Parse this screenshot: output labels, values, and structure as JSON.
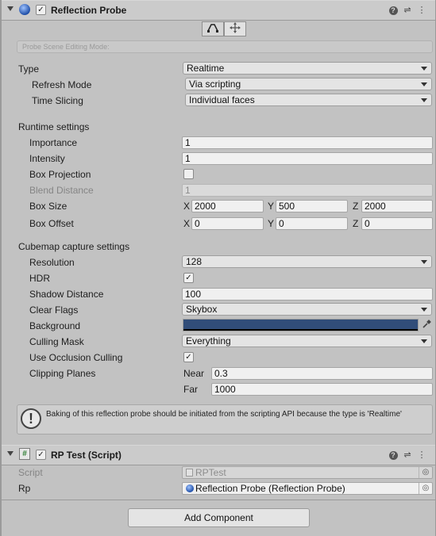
{
  "reflection_probe": {
    "title": "Reflection Probe",
    "enabled": true,
    "edit_mode_placeholder": "Probe Scene Editing Mode:",
    "type_label": "Type",
    "type_value": "Realtime",
    "refresh_mode_label": "Refresh Mode",
    "refresh_mode_value": "Via scripting",
    "time_slicing_label": "Time Slicing",
    "time_slicing_value": "Individual faces",
    "runtime_heading": "Runtime settings",
    "importance_label": "Importance",
    "importance_value": "1",
    "intensity_label": "Intensity",
    "intensity_value": "1",
    "box_projection_label": "Box Projection",
    "box_projection_checked": false,
    "blend_distance_label": "Blend Distance",
    "blend_distance_value": "1",
    "box_size_label": "Box Size",
    "box_size": {
      "x_label": "X",
      "x": "2000",
      "y_label": "Y",
      "y": "500",
      "z_label": "Z",
      "z": "2000"
    },
    "box_offset_label": "Box Offset",
    "box_offset": {
      "x_label": "X",
      "x": "0",
      "y_label": "Y",
      "y": "0",
      "z_label": "Z",
      "z": "0"
    },
    "cubemap_heading": "Cubemap capture settings",
    "resolution_label": "Resolution",
    "resolution_value": "128",
    "hdr_label": "HDR",
    "hdr_checked": true,
    "shadow_distance_label": "Shadow Distance",
    "shadow_distance_value": "100",
    "clear_flags_label": "Clear Flags",
    "clear_flags_value": "Skybox",
    "background_label": "Background",
    "background_color": "#314d79",
    "culling_mask_label": "Culling Mask",
    "culling_mask_value": "Everything",
    "occlusion_label": "Use Occlusion Culling",
    "occlusion_checked": true,
    "clipping_label": "Clipping Planes",
    "near_label": "Near",
    "near_value": "0.3",
    "far_label": "Far",
    "far_value": "1000",
    "help_message": "Baking of this reflection probe should be initiated from the scripting API because the type is 'Realtime'"
  },
  "rp_test": {
    "title": "RP Test (Script)",
    "enabled": true,
    "script_label": "Script",
    "script_value": "RPTest",
    "rp_label": "Rp",
    "rp_value": "Reflection Probe (Reflection Probe)"
  },
  "footer": {
    "add_component_label": "Add Component"
  },
  "icons": {
    "fold": "fold-arrow-icon",
    "probe": "reflection-probe-icon",
    "script": "csharp-script-icon",
    "help": "help-icon",
    "presets": "presets-icon",
    "menu": "kebab-menu-icon",
    "edit_bounds": "edit-bounds-icon",
    "move": "move-icon",
    "warning": "warning-icon",
    "picker": "eyedropper-icon",
    "object_picker": "object-picker-icon"
  }
}
